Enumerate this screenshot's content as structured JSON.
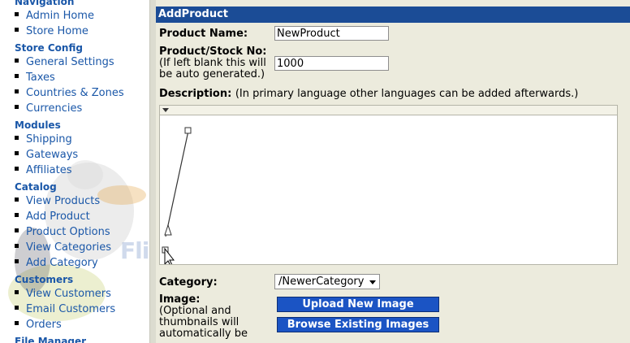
{
  "sidebar": {
    "sections": [
      {
        "title": "Navigation",
        "items": [
          "Admin Home",
          "Store Home"
        ]
      },
      {
        "title": "Store Config",
        "items": [
          "General Settings",
          "Taxes",
          "Countries & Zones",
          "Currencies"
        ]
      },
      {
        "title": "Modules",
        "items": [
          "Shipping",
          "Gateways",
          "Affiliates"
        ]
      },
      {
        "title": "Catalog",
        "items": [
          "View Products",
          "Add Product",
          "Product Options",
          "View Categories",
          "Add Category"
        ]
      },
      {
        "title": "Customers",
        "items": [
          "View Customers",
          "Email Customers",
          "Orders"
        ]
      },
      {
        "title": "File Manager",
        "items": []
      }
    ],
    "watermark": "FlipperHost"
  },
  "main": {
    "title": "AddProduct",
    "product_name_label": "Product Name:",
    "product_name_value": "NewProduct",
    "stock_label": "Product/Stock No:",
    "stock_note_1": "(If left blank this will",
    "stock_note_2": "be auto generated.)",
    "stock_value": "1000",
    "description_label": "Description:",
    "description_note": "(In primary language other languages can be added afterwards.)",
    "category_label": "Category:",
    "category_value": "/NewerCategory",
    "image_label": "Image:",
    "image_note_1": "(Optional and",
    "image_note_2": "thumbnails will",
    "image_note_3": "automatically be",
    "upload_button": "Upload New Image",
    "browse_button": "Browse Existing Images"
  },
  "colors": {
    "header_bg": "#1b4c96",
    "panel_bg": "#ecebdd",
    "link": "#1a57a8",
    "button_bg": "#1b54c4"
  }
}
